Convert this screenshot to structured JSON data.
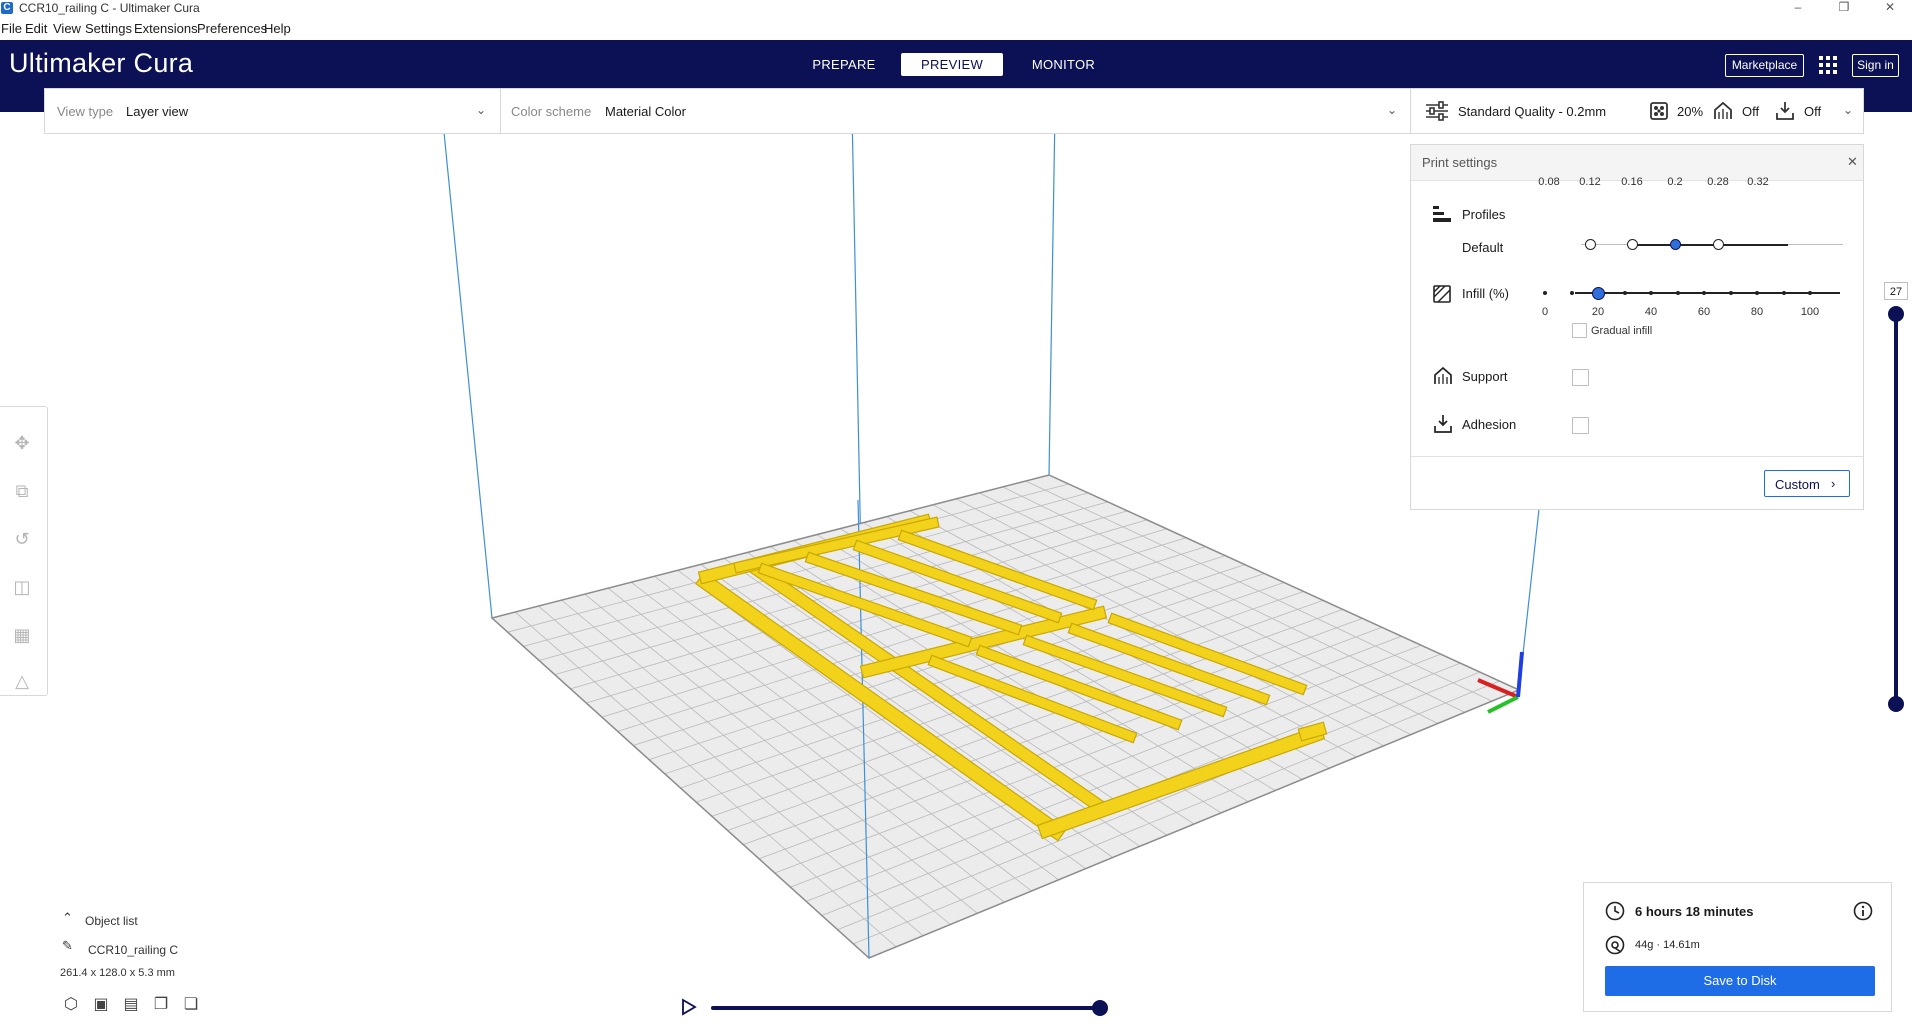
{
  "window": {
    "title": "CCR10_railing C - Ultimaker Cura",
    "app_icon": "cura-app-icon",
    "minimize_icon": "–",
    "maximize_icon": "❐",
    "close_icon": "✕"
  },
  "menu": [
    "File",
    "Edit",
    "View",
    "Settings",
    "Extensions",
    "Preferences",
    "Help"
  ],
  "header": {
    "logo_bold": "Ultimaker",
    "logo_light": " Cura",
    "stages": [
      "PREPARE",
      "PREVIEW",
      "MONITOR"
    ],
    "active_stage": "PREVIEW",
    "marketplace_label": "Marketplace",
    "signin_label": "Sign in"
  },
  "viewbar": {
    "view_type_label": "View type",
    "view_type_value": "Layer view",
    "color_scheme_label": "Color scheme",
    "color_scheme_value": "Material Color",
    "quality": "Standard Quality - 0.2mm",
    "infill": "20%",
    "support": "Off",
    "adhesion": "Off"
  },
  "print_settings": {
    "title": "Print settings",
    "close_icon": "✕",
    "profiles_label": "Profiles",
    "profiles_default": "Default",
    "profile_ticks": [
      "0.08",
      "0.12",
      "0.16",
      "0.2",
      "0.28",
      "0.32"
    ],
    "selected_profile": "0.2",
    "infill_label": "Infill (%)",
    "infill_ticks": [
      "0",
      "20",
      "40",
      "60",
      "80",
      "100"
    ],
    "infill_value": 20,
    "gradual_infill_label": "Gradual infill",
    "support_label": "Support",
    "adhesion_label": "Adhesion",
    "custom_label": "Custom"
  },
  "layer_slider": {
    "value": "27"
  },
  "object_list": {
    "header": "Object list",
    "item": "CCR10_railing C",
    "dimensions": "261.4 x 128.0 x 5.3 mm"
  },
  "job": {
    "time": "6 hours 18 minutes",
    "material": "44g · 14.61m",
    "save_label": "Save to Disk"
  },
  "colors": {
    "header_bg": "#0c1054",
    "accent": "#1e6ce6",
    "model": "#f3d21b"
  }
}
